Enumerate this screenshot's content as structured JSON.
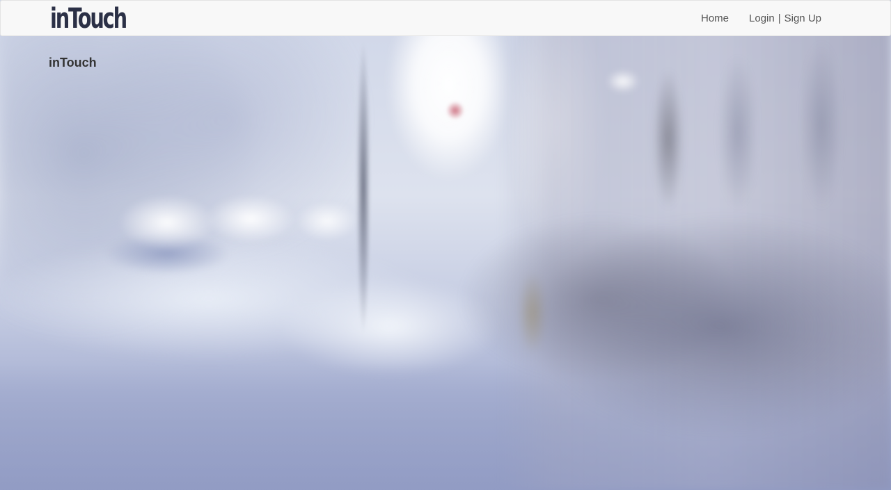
{
  "navbar": {
    "brand": "inTouch",
    "links": {
      "home": "Home",
      "login": "Login",
      "separator": "|",
      "signup": "Sign Up"
    }
  },
  "main": {
    "heading": "inTouch"
  },
  "colors": {
    "navbar_bg": "#f8f8f8",
    "brand_color": "#2b3046",
    "link_color": "#555555",
    "heading_color": "#333333"
  }
}
